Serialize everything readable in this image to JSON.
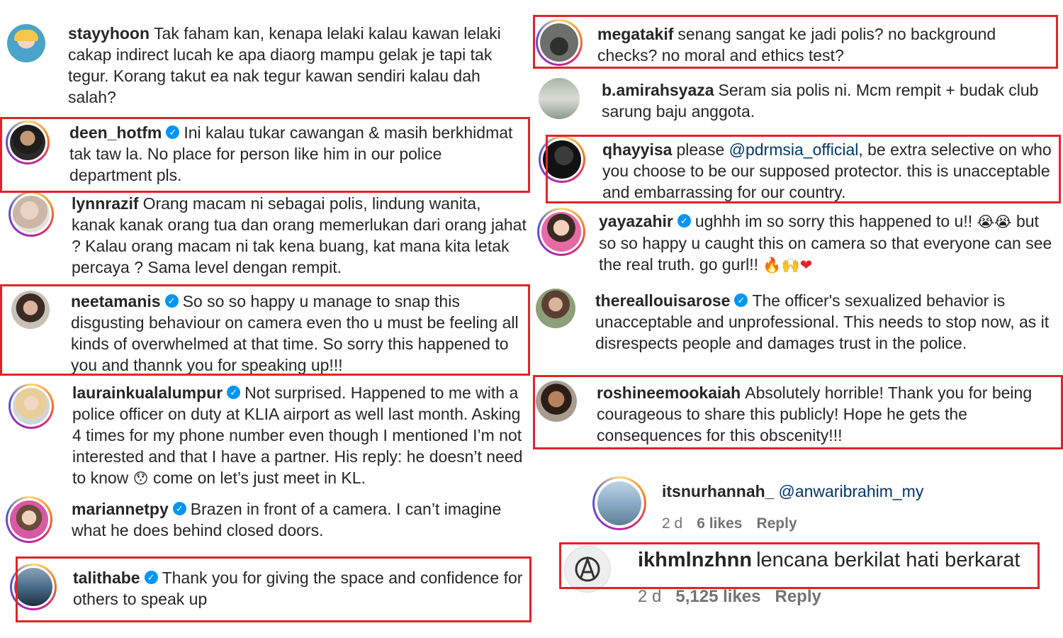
{
  "comments": [
    {
      "user": "stayyhoon",
      "verified": false,
      "text": "Tak faham kan, kenapa lelaki kalau kawan lelaki cakap indirect lucah ke apa diaorg mampu gelak je tapi tak tegur. Korang takut ea nak tegur kawan sendiri kalau dah salah?"
    },
    {
      "user": "deen_hotfm",
      "verified": true,
      "text": "Ini kalau tukar cawangan & masih berkhidmat tak taw la. No place for person like him in our police department pls."
    },
    {
      "user": "lynnrazif",
      "verified": false,
      "text": "Orang macam ni sebagai polis, lindung wanita, kanak kanak orang tua dan orang memerlukan dari orang jahat ? Kalau orang macam ni tak kena buang, kat mana kita letak percaya ? Sama level dengan rempit."
    },
    {
      "user": "neetamanis",
      "verified": true,
      "text": "So so so happy u manage to snap this disgusting behaviour on camera even tho u must be feeling all kinds of overwhelmed at that time. So sorry this happened to you and thannk you for speaking up!!!"
    },
    {
      "user": "laurainkualalumpur",
      "verified": true,
      "text": "Not surprised. Happened to me with a police officer on duty at KLIA airport as well last month. Asking 4 times for my phone number even though I mentioned I’m not interested and that I have a partner. His reply: he doesn’t need to know",
      "text_after": "come on let’s just meet in KL.",
      "emoji": "😯"
    },
    {
      "user": "mariannetpy",
      "verified": true,
      "text": "Brazen in front of a camera. I can’t imagine what he does behind closed doors."
    },
    {
      "user": "talithabe",
      "verified": true,
      "text": "Thank you for giving the space and confidence for others to speak up"
    },
    {
      "user": "megatakif",
      "verified": false,
      "text": "senang sangat ke jadi polis? no background checks? no moral and ethics test?"
    },
    {
      "user": "b.amirahsyaza",
      "verified": false,
      "text": "Seram sia polis ni. Mcm rempit + budak club sarung baju anggota."
    },
    {
      "user": "qhayyisa",
      "verified": false,
      "text_before": "please",
      "mention": "@pdrmsia_official",
      "text": ", be extra selective on who you choose to be our supposed protector. this is unacceptable and embarrassing for our country."
    },
    {
      "user": "yayazahir",
      "verified": true,
      "text": "ughhh im so sorry this happened to u!!",
      "emoji": "😭😭",
      "text_after": "but so so happy u caught this on camera so that everyone can see the real truth. go gurl!!",
      "emoji_end": "🔥🙌❤"
    },
    {
      "user": "thereallouisarose",
      "verified": true,
      "text": "The officer's sexualized behavior is unacceptable and unprofessional. This needs to stop now, as it disrespects people and damages trust in the police."
    },
    {
      "user": "roshineemookaiah",
      "verified": false,
      "text": "Absolutely horrible! Thank you for being courageous to share this publicly! Hope he gets the consequences for this obscenity!!!"
    },
    {
      "user": "itsnurhannah_",
      "verified": false,
      "mention": "@anwaribrahim_my",
      "time": "2 d",
      "likes": "6 likes",
      "reply": "Reply"
    },
    {
      "user": "ikhmlnzhnn",
      "verified": false,
      "text": "lencana berkilat hati berkarat",
      "time": "2 d",
      "likes": "5,125 likes",
      "reply": "Reply"
    }
  ],
  "colors": {
    "highlight": "#e0242b",
    "verified": "#0095f6",
    "mention": "#00376b",
    "meta": "#737373"
  },
  "icons": [
    "verified-badge-icon",
    "anarchy-avatar-icon"
  ]
}
